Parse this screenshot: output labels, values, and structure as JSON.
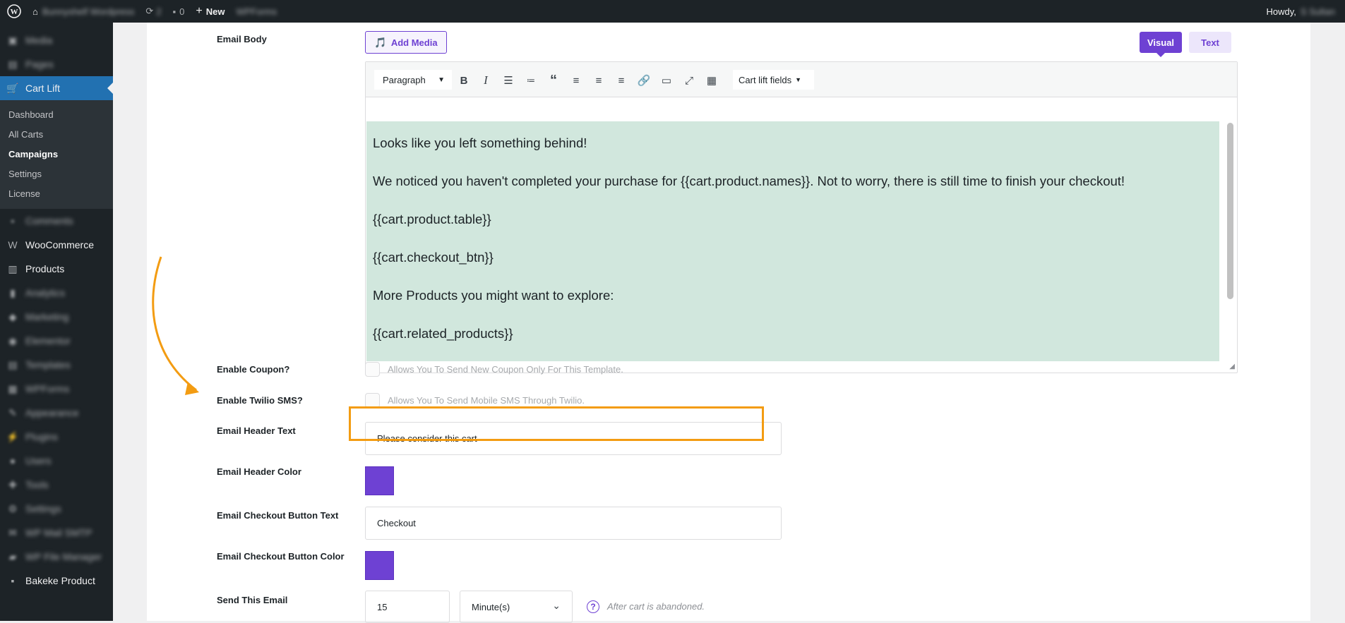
{
  "admin_bar": {
    "site_name": "Bunnyshelf Wordpress",
    "updates": "2",
    "comments": "0",
    "new_label": "New",
    "wpforms": "WPForms",
    "howdy": "Howdy,",
    "user": "S Sultan"
  },
  "sidebar": {
    "items_top": [
      {
        "label": "Media",
        "icon": "media-icon"
      },
      {
        "label": "Pages",
        "icon": "pages-icon"
      }
    ],
    "active_item": {
      "label": "Cart Lift",
      "icon": "cart-icon"
    },
    "submenu": [
      "Dashboard",
      "All Carts",
      "Campaigns",
      "Settings",
      "License"
    ],
    "current_submenu": "Campaigns",
    "items_bottom": [
      {
        "label": "Comments",
        "icon": "comments-icon",
        "blurred": true
      },
      {
        "label": "WooCommerce",
        "icon": "woo-icon",
        "blurred": false
      },
      {
        "label": "Products",
        "icon": "products-icon",
        "blurred": false
      },
      {
        "label": "Analytics",
        "icon": "analytics-icon",
        "blurred": true
      },
      {
        "label": "Marketing",
        "icon": "marketing-icon",
        "blurred": true
      },
      {
        "label": "Elementor",
        "icon": "elementor-icon",
        "blurred": true
      },
      {
        "label": "Templates",
        "icon": "templates-icon",
        "blurred": true
      },
      {
        "label": "WPForms",
        "icon": "wpforms-icon",
        "blurred": true
      },
      {
        "label": "Appearance",
        "icon": "appearance-icon",
        "blurred": true
      },
      {
        "label": "Plugins",
        "icon": "plugins-icon",
        "blurred": true
      },
      {
        "label": "Users",
        "icon": "users-icon",
        "blurred": true
      },
      {
        "label": "Tools",
        "icon": "tools-icon",
        "blurred": true
      },
      {
        "label": "Settings",
        "icon": "settings-icon",
        "blurred": true
      },
      {
        "label": "WP Mail SMTP",
        "icon": "mail-icon",
        "blurred": true
      },
      {
        "label": "WP File Manager",
        "icon": "file-manager-icon",
        "blurred": true
      },
      {
        "label": "Bakeke Product",
        "icon": "bakeke-icon",
        "blurred": false
      }
    ]
  },
  "form": {
    "email_body_label": "Email Body",
    "add_media": "Add Media",
    "tab_visual": "Visual",
    "tab_text": "Text",
    "format_select": "Paragraph",
    "cart_lift_fields": "Cart lift fields",
    "body_lines": [
      "Looks like you left something behind!",
      "We noticed you haven't completed your purchase for {{cart.product.names}}. Not to worry, there is still time to finish your checkout!",
      "{{cart.product.table}}",
      "{{cart.checkout_btn}}",
      "More Products you might want to explore:",
      "{{cart.related_products}}"
    ],
    "enable_coupon_label": "Enable Coupon?",
    "enable_coupon_desc": "Allows You To Send New Coupon Only For This Template.",
    "enable_twilio_label": "Enable Twilio SMS?",
    "enable_twilio_desc": "Allows You To Send Mobile SMS Through Twilio.",
    "header_text_label": "Email Header Text",
    "header_text_value": "Please consider this cart",
    "header_color_label": "Email Header Color",
    "header_color": "#6e41d3",
    "checkout_text_label": "Email Checkout Button Text",
    "checkout_text_value": "Checkout",
    "checkout_color_label": "Email Checkout Button Color",
    "checkout_color": "#6e41d3",
    "send_label": "Send This Email",
    "send_value": "15",
    "send_unit": "Minute(s)",
    "send_help": "After cart is abandoned."
  },
  "colors": {
    "accent": "#6e41d3",
    "highlight": "#f39c12",
    "editor_bg": "#d1e7dd"
  }
}
